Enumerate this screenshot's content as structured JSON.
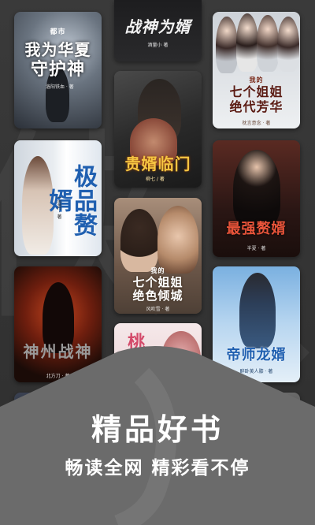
{
  "colors": {
    "background": "#333333",
    "banner": "#6b6b6b",
    "banner_text": "#ffffff"
  },
  "books": [
    {
      "title_line1": "我为华夏",
      "title_line2": "守护神",
      "tag": "都市",
      "theme": "storm",
      "author": "洛阳铁血 · 著"
    },
    {
      "title_line1": "战神为婿",
      "title_line2": "",
      "tag": "",
      "theme": "dark",
      "author": "酒量小 著"
    },
    {
      "title_line1": "七个姐姐",
      "title_line2": "绝代芳华",
      "tag": "我的",
      "theme": "beauties",
      "author": "枕言意念 · 著"
    },
    {
      "title_line1": "贵婿临门",
      "title_line2": "",
      "tag": "",
      "theme": "couple-dark",
      "author": "柳七 / 著"
    },
    {
      "title_line1": "极品赘婿",
      "title_line2": "",
      "tag": "",
      "theme": "bride",
      "author": "一壶月 · 著"
    },
    {
      "title_line1": "最强赘婿",
      "title_line2": "",
      "tag": "",
      "theme": "suit",
      "author": "半夏 · 著"
    },
    {
      "title_line1": "七个姐姐",
      "title_line2": "绝色倾城",
      "tag": "我的",
      "theme": "couple-warm",
      "author": "风吹雪 · 著"
    },
    {
      "title_line1": "神州战神",
      "title_line2": "",
      "tag": "",
      "theme": "fire",
      "author": "北方刀 · 著"
    },
    {
      "title_line1": "帝师龙婿",
      "title_line2": "",
      "tag": "",
      "theme": "sky",
      "author": "醉卧美人膝 · 著"
    },
    {
      "title_line1": "桃运",
      "title_line2": "",
      "tag": "",
      "theme": "pink",
      "author": ""
    }
  ],
  "banner": {
    "title": "精品好书",
    "subtitle": "畅读全网 精彩看不停"
  }
}
